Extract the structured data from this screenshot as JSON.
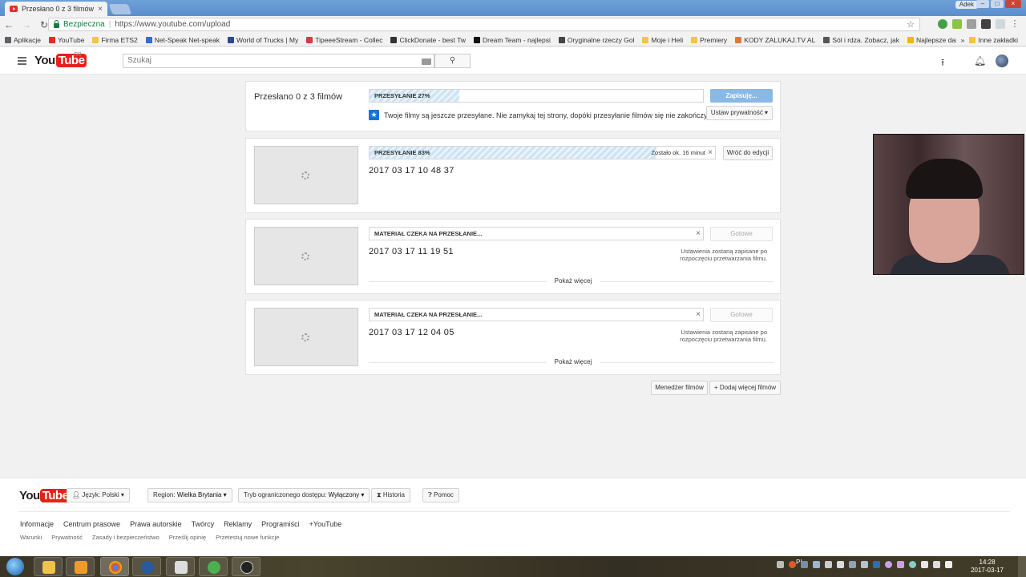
{
  "browser": {
    "tab_title": "Przesłano 0 z 3 filmów -",
    "tab_close": "×",
    "user_badge": "Adek",
    "secure_label": "Bezpieczna",
    "url": "https://www.youtube.com/upload",
    "bookmarks": [
      {
        "label": "Aplikacje",
        "color": "#5f6368"
      },
      {
        "label": "YouTube",
        "color": "#e52d27"
      },
      {
        "label": "Firma ETS2",
        "color": "#f4c542"
      },
      {
        "label": "Net-Speak Net-speak",
        "color": "#2a6fdb"
      },
      {
        "label": "World of Trucks | My",
        "color": "#2b4a8a"
      },
      {
        "label": "TipeeeStream - Collec",
        "color": "#d93a4a"
      },
      {
        "label": "ClickDonate - best Tw",
        "color": "#333333"
      },
      {
        "label": "Dream Team - najlepsi",
        "color": "#111111"
      },
      {
        "label": "Oryginalne rzeczy Gol",
        "color": "#444444"
      },
      {
        "label": "Moje i Heli",
        "color": "#f4c542"
      },
      {
        "label": "Premiery",
        "color": "#f4c542"
      },
      {
        "label": "KODY ZALUKAJ.TV AL",
        "color": "#e8762b"
      },
      {
        "label": "Sól i rdza. Zobacz, jak",
        "color": "#555555"
      },
      {
        "label": "Najlepsze darmowe p",
        "color": "#f2b705"
      }
    ],
    "more_bookmarks": "»",
    "other_bookmarks": "Inne zakładki"
  },
  "header": {
    "logo_you": "You",
    "logo_tube": "Tube",
    "logo_region": "GB",
    "search_placeholder": "Szukaj"
  },
  "summary": {
    "title": "Przesłano 0 z 3 filmów",
    "progress_label": "PRZESYŁANIE 27%",
    "progress": 0.27,
    "save_button": "Zapisuję...",
    "info_text": "Twoje filmy są jeszcze przesyłane. Nie zamykaj tej strony, dopóki przesyłanie filmów się nie zakończy.",
    "privacy_button": "Ustaw prywatność ▾"
  },
  "uploads": [
    {
      "title": "2017 03 17 10 48 37",
      "status": "PRZESYŁANIE 83%",
      "progress": 0.83,
      "remaining": "Zostało ok. 16 minut",
      "action": "Wróć do edycji",
      "close": "×"
    },
    {
      "title": "2017 03 17 11 19 51",
      "status": "MATERIAŁ CZEKA NA PRZESŁANIE...",
      "progress": 0,
      "action": "Gotowe",
      "note": "Ustawienia zostaną zapisane po rozpoczęciu przetwarzania filmu.",
      "more": "Pokaż więcej",
      "close": "×"
    },
    {
      "title": "2017 03 17 12 04 05",
      "status": "MATERIAŁ CZEKA NA PRZESŁANIE...",
      "progress": 0,
      "action": "Gotowe",
      "note": "Ustawienia zostaną zapisane po rozpoczęciu przetwarzania filmu.",
      "more": "Pokaż więcej",
      "close": "×"
    }
  ],
  "bottom_actions": {
    "manager": "Menedżer filmów",
    "add_more": "+ Dodaj więcej filmów"
  },
  "footer": {
    "logo_you": "You",
    "logo_tube": "Tube",
    "language_label": "Język: Polski ▾",
    "region_label": "Region:",
    "region_value": "Wielka Brytania ▾",
    "restricted_label": "Tryb ograniczonego dostępu:",
    "restricted_value": "Wyłączony ▾",
    "history": "Historia",
    "help": "Pomoc",
    "links_primary": [
      "Informacje",
      "Centrum prasowe",
      "Prawa autorskie",
      "Twórcy",
      "Reklamy",
      "Programiści",
      "+YouTube"
    ],
    "links_secondary": [
      "Warunki",
      "Prywatność",
      "Zasady i bezpieczeństwo",
      "Prześlij opinię",
      "Przetestuj nowe funkcje"
    ]
  },
  "taskbar": {
    "language": "PL",
    "time": "14:28",
    "date": "2017-03-17"
  },
  "colors": {
    "accent_blue": "#1b72d8",
    "yt_red": "#e62117",
    "primary_button": "#8ab9e6"
  }
}
